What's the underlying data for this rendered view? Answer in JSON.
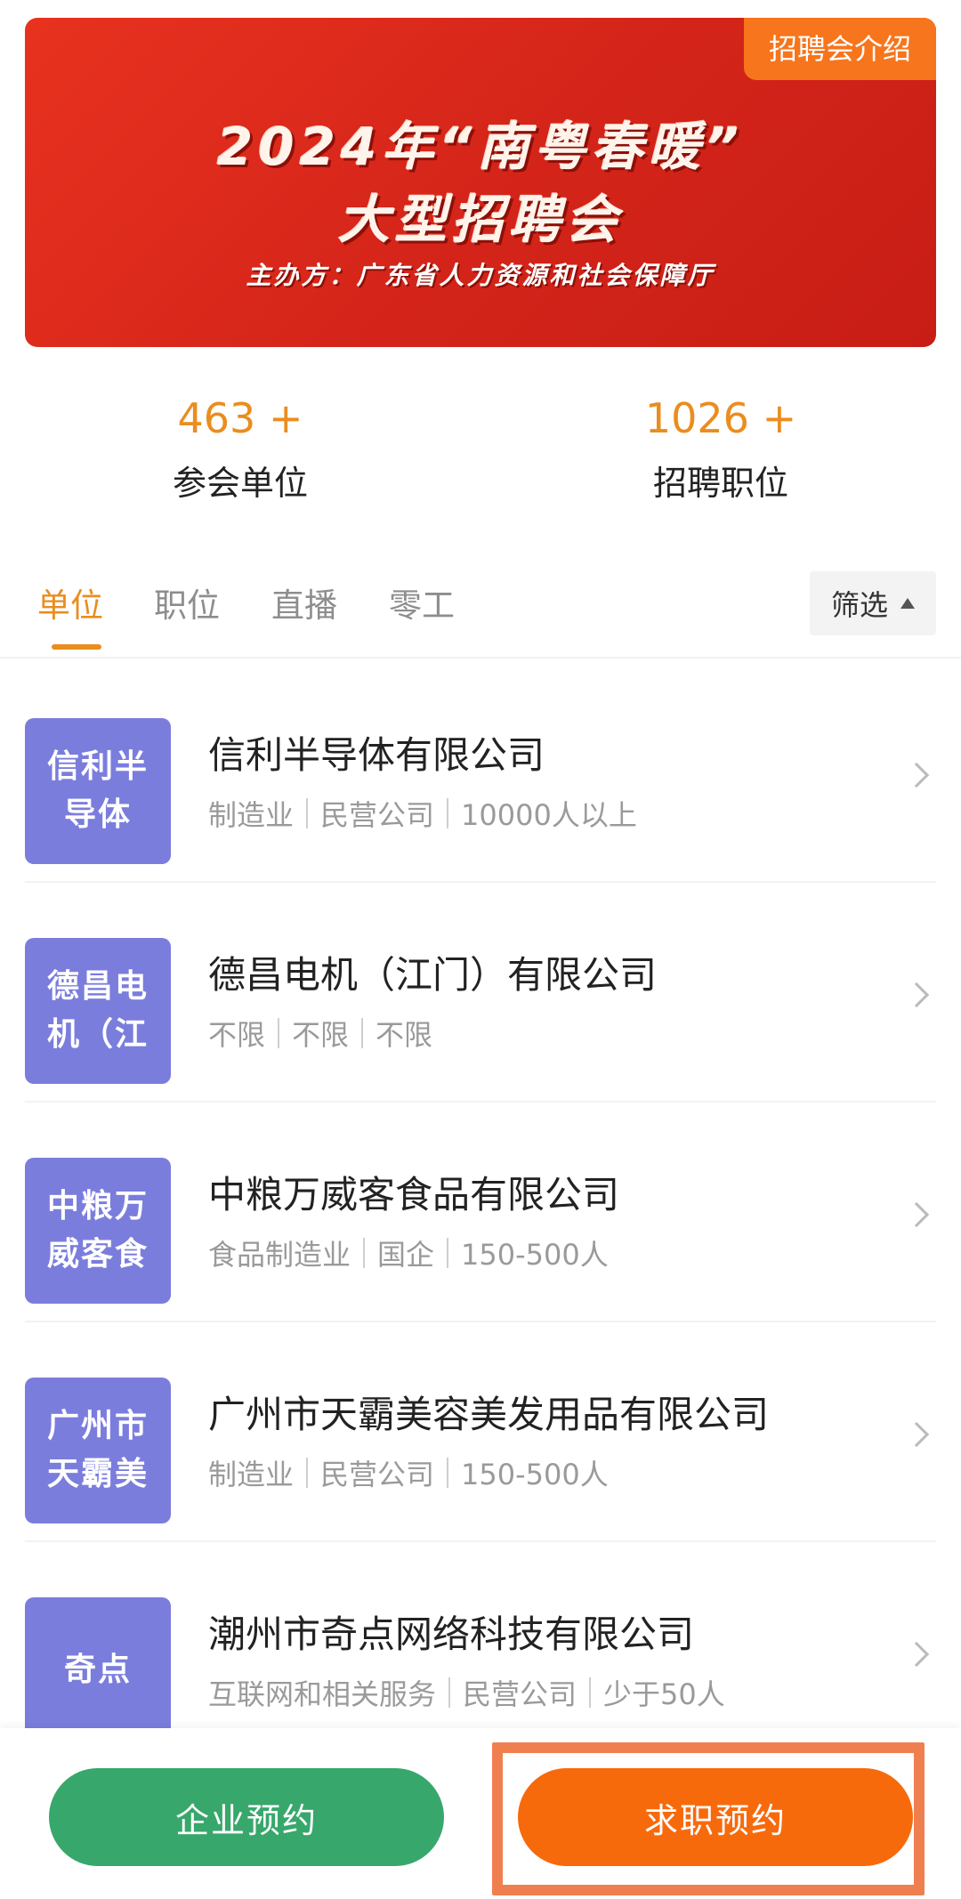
{
  "banner": {
    "intro_label": "招聘会介绍",
    "title_line1": "2024年“南粤春暖”",
    "title_line2": "大型招聘会",
    "organizer": "主办方：广东省人力资源和社会保障厅",
    "bg_color": "#d5251a"
  },
  "stats": [
    {
      "number": "463 +",
      "label": "参会单位"
    },
    {
      "number": "1026 +",
      "label": "招聘职位"
    }
  ],
  "tabs": [
    "单位",
    "职位",
    "直播",
    "零工"
  ],
  "active_tab": "单位",
  "filter_label": "筛选",
  "companies": [
    {
      "logo_text": "信利半导体",
      "name": "信利半导体有限公司",
      "tags": [
        "制造业",
        "民营公司",
        "10000人以上"
      ]
    },
    {
      "logo_text": "德昌电机（江",
      "name": "德昌电机（江门）有限公司",
      "tags": [
        "不限",
        "不限",
        "不限"
      ]
    },
    {
      "logo_text": "中粮万威客食",
      "name": "中粮万威客食品有限公司",
      "tags": [
        "食品制造业",
        "国企",
        "150-500人"
      ]
    },
    {
      "logo_text": "广州市天霸美",
      "name": "广州市天霸美容美发用品有限公司",
      "tags": [
        "制造业",
        "民营公司",
        "150-500人"
      ]
    },
    {
      "logo_text": "奇点",
      "name": "潮州市奇点网络科技有限公司",
      "tags": [
        "互联网和相关服务",
        "民营公司",
        "少于50人"
      ]
    }
  ],
  "bottom": {
    "enterprise_btn": "企业预约",
    "job_btn": "求职预约"
  },
  "colors": {
    "accent": "#ea8d1f",
    "logo_bg": "#7b7ddd",
    "green": "#38a76c",
    "orange": "#f76a0c"
  }
}
